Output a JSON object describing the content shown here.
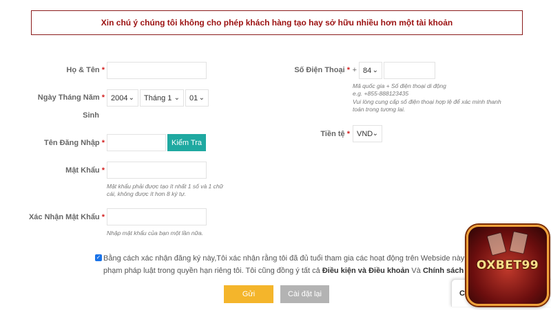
{
  "notice": "Xin chú ý chúng tôi không cho phép khách hàng tạo hay sở hữu nhiều hơn một tài khoản",
  "required_mark": "*",
  "form": {
    "full_name_label": "Họ & Tên",
    "dob_label_line1": "Ngày Tháng Năm",
    "dob_label_line2": "Sinh",
    "dob_year": "2004",
    "dob_month": "Tháng 1",
    "dob_day": "01",
    "username_label": "Tên Đăng Nhập",
    "check_button": "Kiểm Tra",
    "password_label": "Mật Khẩu",
    "password_hint": "Mật khẩu phải được tạo ít nhất 1 số và 1 chữ cái, không được ít hơn 8 ký tự.",
    "confirm_label": "Xác Nhận Mật Khẩu",
    "confirm_hint": "Nhập mật khẩu của bạn một lần nữa.",
    "phone_label": "Số Điện Thoại",
    "phone_plus": "+",
    "phone_code": "84",
    "phone_hint_1": "Mã quốc gia + Số điện thoại di động",
    "phone_hint_2": "e.g. +855-888123435",
    "phone_hint_3": "Vui lòng cung cấp số điện thoại hợp lệ để xác minh thanh toán trong tương lai.",
    "currency_label": "Tiền tệ",
    "currency_value": "VND"
  },
  "agreement": {
    "text_1": "Bằng cách xác nhận đăng ký này,Tôi xác nhận rằng tôi đã đủ tuổi tham gia các hoạt động trên Webside này không",
    "text_2": "phạm pháp luật trong quyền hạn riêng tôi. Tôi cũng đồng ý tất cả",
    "terms": "Điều kiện và Điều khoản",
    "and": "Và",
    "privacy": "Chính sách bảo m"
  },
  "buttons": {
    "submit": "Gửi",
    "reset": "Cài đặt lại"
  },
  "chat_widget_text": "Cl",
  "logo_text": "OXBET99",
  "icons": {
    "chevron": "chevron-down-icon",
    "check": "check-icon"
  }
}
